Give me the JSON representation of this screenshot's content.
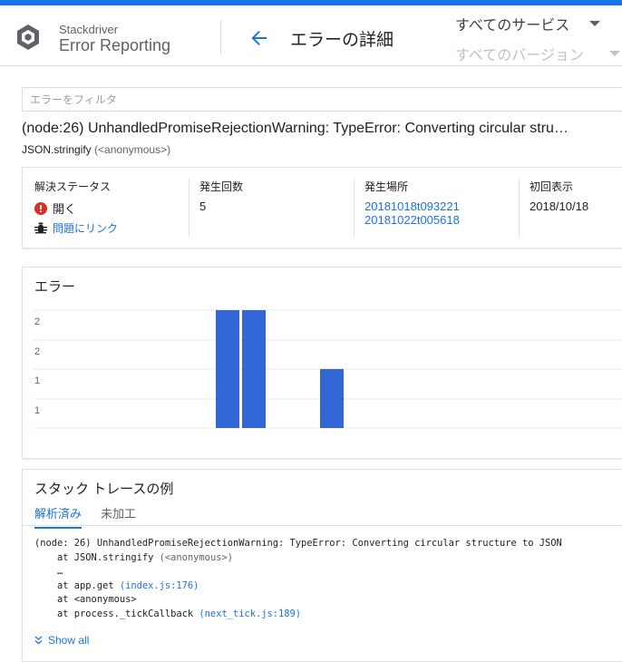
{
  "header": {
    "brand_small": "Stackdriver",
    "brand_big": "Error Reporting",
    "page_title": "エラーの詳細",
    "service_select": "すべてのサービス",
    "version_select": "すべてのバージョン",
    "accent": "#1a73e8"
  },
  "filter": {
    "placeholder": "エラーをフィルタ"
  },
  "error": {
    "title": "(node:26) UnhandledPromiseRejectionWarning: TypeError: Converting circular stru…",
    "function": "JSON.stringify",
    "context": "(<anonymous>)"
  },
  "stats": {
    "resolution_label": "解決ステータス",
    "status": "開く",
    "status_color": "#d93025",
    "link_issue": "問題にリンク",
    "count_label": "発生回数",
    "count": "5",
    "location_label": "発生場所",
    "locations": [
      "20181018t093221",
      "20181022t005618"
    ],
    "first_seen_label": "初回表示",
    "first_seen": "2018/10/18"
  },
  "chart": {
    "title": "エラー",
    "y_tick_labels": [
      "2",
      "2",
      "1",
      "1"
    ]
  },
  "chart_data": {
    "type": "bar",
    "title": "エラー",
    "xlabel": "",
    "ylabel": "",
    "ylim": [
      0,
      2
    ],
    "grid": true,
    "bar_color": "#3367d6",
    "values": [
      2,
      2,
      1
    ]
  },
  "stack": {
    "title": "スタック トレースの例",
    "tabs": [
      "解析済み",
      "未加工"
    ],
    "show_all": "Show all",
    "lines": [
      {
        "indent": "",
        "prefix": "",
        "text": "(node: 26) UnhandledPromiseRejectionWarning: TypeError: Converting circular structure to JSON",
        "link": "",
        "suffix": ""
      },
      {
        "indent": "    ",
        "prefix": "at ",
        "text": "JSON.stringify ",
        "muted": "(<anonymous>)",
        "link": "",
        "suffix": ""
      },
      {
        "indent": "    ",
        "prefix": "",
        "text": "…",
        "link": "",
        "suffix": ""
      },
      {
        "indent": "    ",
        "prefix": "at ",
        "text": "app.get ",
        "link": "(index.js:176)",
        "suffix": ""
      },
      {
        "indent": "    ",
        "prefix": "at ",
        "text": "<anonymous>",
        "link": "",
        "suffix": ""
      },
      {
        "indent": "    ",
        "prefix": "at ",
        "text": "process._tickCallback ",
        "link": "(next_tick.js:189)",
        "suffix": ""
      }
    ]
  }
}
